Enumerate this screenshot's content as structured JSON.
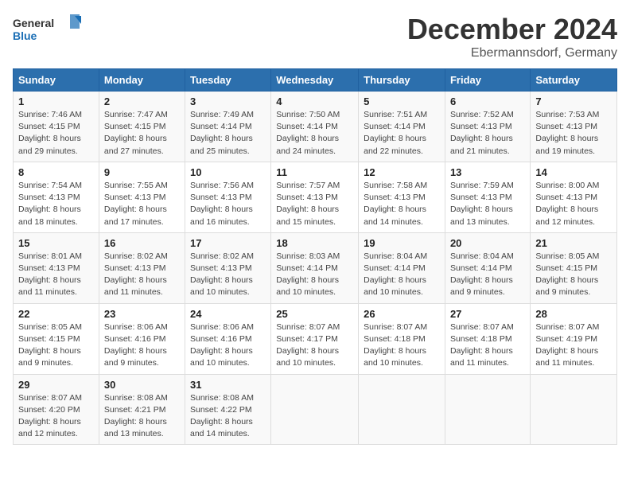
{
  "logo": {
    "line1": "General",
    "line2": "Blue"
  },
  "title": "December 2024",
  "subtitle": "Ebermannsdorf, Germany",
  "days_of_week": [
    "Sunday",
    "Monday",
    "Tuesday",
    "Wednesday",
    "Thursday",
    "Friday",
    "Saturday"
  ],
  "weeks": [
    [
      {
        "day": "1",
        "info": "Sunrise: 7:46 AM\nSunset: 4:15 PM\nDaylight: 8 hours\nand 29 minutes."
      },
      {
        "day": "2",
        "info": "Sunrise: 7:47 AM\nSunset: 4:15 PM\nDaylight: 8 hours\nand 27 minutes."
      },
      {
        "day": "3",
        "info": "Sunrise: 7:49 AM\nSunset: 4:14 PM\nDaylight: 8 hours\nand 25 minutes."
      },
      {
        "day": "4",
        "info": "Sunrise: 7:50 AM\nSunset: 4:14 PM\nDaylight: 8 hours\nand 24 minutes."
      },
      {
        "day": "5",
        "info": "Sunrise: 7:51 AM\nSunset: 4:14 PM\nDaylight: 8 hours\nand 22 minutes."
      },
      {
        "day": "6",
        "info": "Sunrise: 7:52 AM\nSunset: 4:13 PM\nDaylight: 8 hours\nand 21 minutes."
      },
      {
        "day": "7",
        "info": "Sunrise: 7:53 AM\nSunset: 4:13 PM\nDaylight: 8 hours\nand 19 minutes."
      }
    ],
    [
      {
        "day": "8",
        "info": "Sunrise: 7:54 AM\nSunset: 4:13 PM\nDaylight: 8 hours\nand 18 minutes."
      },
      {
        "day": "9",
        "info": "Sunrise: 7:55 AM\nSunset: 4:13 PM\nDaylight: 8 hours\nand 17 minutes."
      },
      {
        "day": "10",
        "info": "Sunrise: 7:56 AM\nSunset: 4:13 PM\nDaylight: 8 hours\nand 16 minutes."
      },
      {
        "day": "11",
        "info": "Sunrise: 7:57 AM\nSunset: 4:13 PM\nDaylight: 8 hours\nand 15 minutes."
      },
      {
        "day": "12",
        "info": "Sunrise: 7:58 AM\nSunset: 4:13 PM\nDaylight: 8 hours\nand 14 minutes."
      },
      {
        "day": "13",
        "info": "Sunrise: 7:59 AM\nSunset: 4:13 PM\nDaylight: 8 hours\nand 13 minutes."
      },
      {
        "day": "14",
        "info": "Sunrise: 8:00 AM\nSunset: 4:13 PM\nDaylight: 8 hours\nand 12 minutes."
      }
    ],
    [
      {
        "day": "15",
        "info": "Sunrise: 8:01 AM\nSunset: 4:13 PM\nDaylight: 8 hours\nand 11 minutes."
      },
      {
        "day": "16",
        "info": "Sunrise: 8:02 AM\nSunset: 4:13 PM\nDaylight: 8 hours\nand 11 minutes."
      },
      {
        "day": "17",
        "info": "Sunrise: 8:02 AM\nSunset: 4:13 PM\nDaylight: 8 hours\nand 10 minutes."
      },
      {
        "day": "18",
        "info": "Sunrise: 8:03 AM\nSunset: 4:14 PM\nDaylight: 8 hours\nand 10 minutes."
      },
      {
        "day": "19",
        "info": "Sunrise: 8:04 AM\nSunset: 4:14 PM\nDaylight: 8 hours\nand 10 minutes."
      },
      {
        "day": "20",
        "info": "Sunrise: 8:04 AM\nSunset: 4:14 PM\nDaylight: 8 hours\nand 9 minutes."
      },
      {
        "day": "21",
        "info": "Sunrise: 8:05 AM\nSunset: 4:15 PM\nDaylight: 8 hours\nand 9 minutes."
      }
    ],
    [
      {
        "day": "22",
        "info": "Sunrise: 8:05 AM\nSunset: 4:15 PM\nDaylight: 8 hours\nand 9 minutes."
      },
      {
        "day": "23",
        "info": "Sunrise: 8:06 AM\nSunset: 4:16 PM\nDaylight: 8 hours\nand 9 minutes."
      },
      {
        "day": "24",
        "info": "Sunrise: 8:06 AM\nSunset: 4:16 PM\nDaylight: 8 hours\nand 10 minutes."
      },
      {
        "day": "25",
        "info": "Sunrise: 8:07 AM\nSunset: 4:17 PM\nDaylight: 8 hours\nand 10 minutes."
      },
      {
        "day": "26",
        "info": "Sunrise: 8:07 AM\nSunset: 4:18 PM\nDaylight: 8 hours\nand 10 minutes."
      },
      {
        "day": "27",
        "info": "Sunrise: 8:07 AM\nSunset: 4:18 PM\nDaylight: 8 hours\nand 11 minutes."
      },
      {
        "day": "28",
        "info": "Sunrise: 8:07 AM\nSunset: 4:19 PM\nDaylight: 8 hours\nand 11 minutes."
      }
    ],
    [
      {
        "day": "29",
        "info": "Sunrise: 8:07 AM\nSunset: 4:20 PM\nDaylight: 8 hours\nand 12 minutes."
      },
      {
        "day": "30",
        "info": "Sunrise: 8:08 AM\nSunset: 4:21 PM\nDaylight: 8 hours\nand 13 minutes."
      },
      {
        "day": "31",
        "info": "Sunrise: 8:08 AM\nSunset: 4:22 PM\nDaylight: 8 hours\nand 14 minutes."
      },
      null,
      null,
      null,
      null
    ]
  ]
}
